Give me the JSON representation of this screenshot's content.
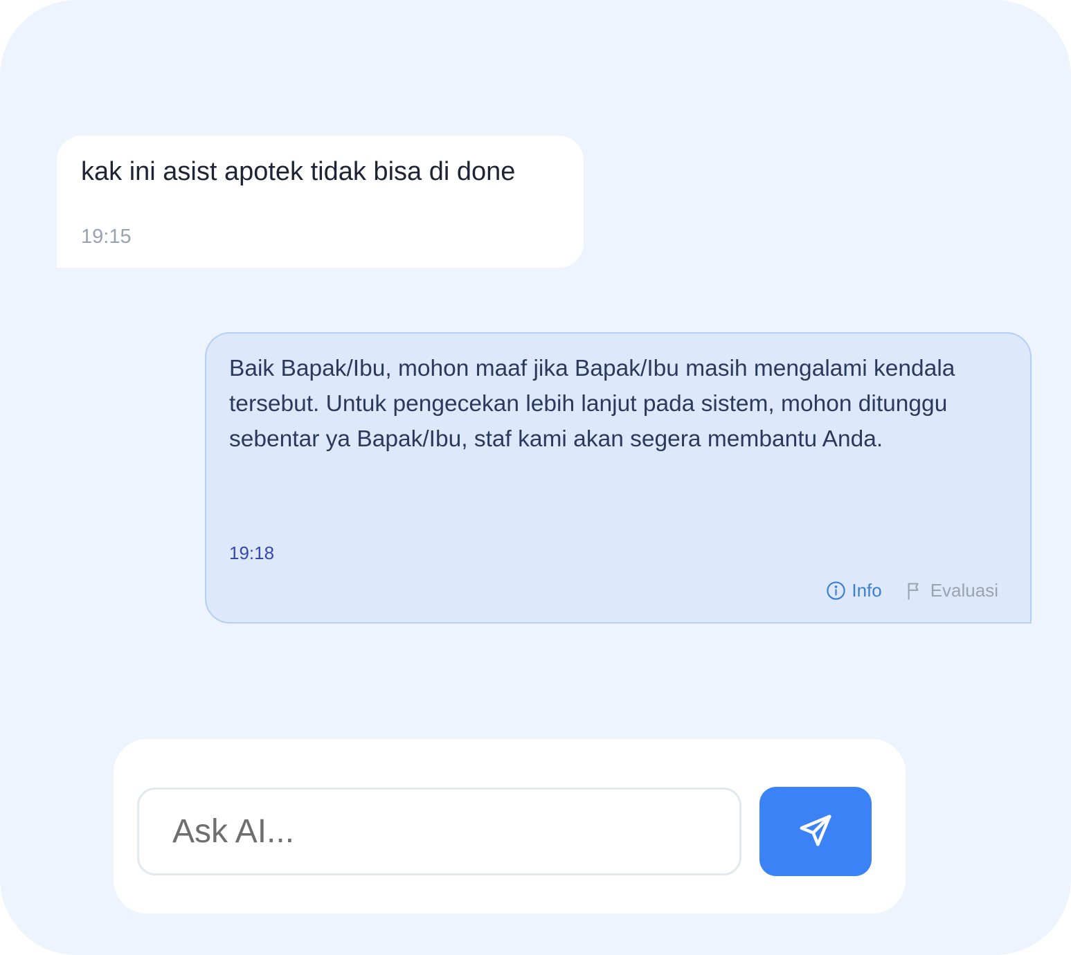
{
  "messages": {
    "user": {
      "text": "kak ini asist apotek tidak bisa di done",
      "time": "19:15"
    },
    "bot": {
      "text": "Baik Bapak/Ibu, mohon maaf jika Bapak/Ibu masih mengalami kendala tersebut. Untuk pengecekan lebih lanjut pada sistem, mohon ditunggu sebentar ya Bapak/Ibu, staf kami akan segera membantu Anda.",
      "time": "19:18",
      "actions": {
        "info_label": "Info",
        "info_icon": "info-circle-icon",
        "evaluate_label": "Evaluasi",
        "evaluate_icon": "flag-icon"
      }
    }
  },
  "composer": {
    "placeholder": "Ask AI...",
    "value": "",
    "send_icon": "send-paper-plane-icon"
  },
  "colors": {
    "background": "#edf4fe",
    "bot_bubble": "#dde8fb",
    "accent": "#3b82f6",
    "info": "#3b7fcf"
  }
}
